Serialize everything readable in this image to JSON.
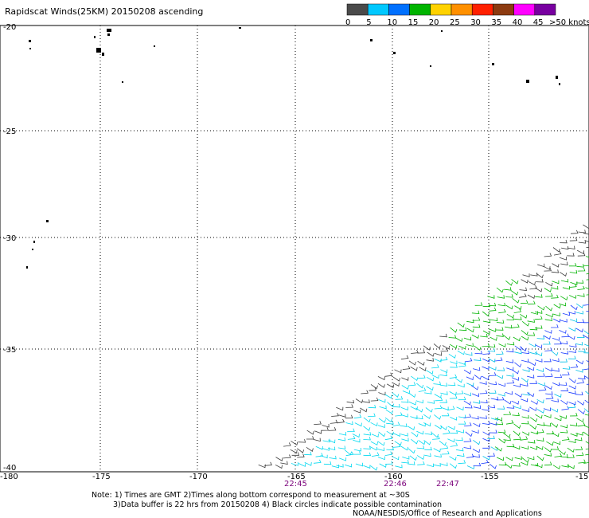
{
  "title": "Rapidscat Winds(25KM) 20150208 ascending",
  "legend": {
    "colors": [
      "#4a4a4a",
      "#00c8ff",
      "#0070ff",
      "#00b400",
      "#ffd200",
      "#ff9000",
      "#ff2000",
      "#8c3a10",
      "#ff00ff",
      "#7800a0"
    ],
    "labels": [
      "0",
      "5",
      "10",
      "15",
      "20",
      "25",
      "30",
      "35",
      "40",
      "45",
      ">50 knots"
    ]
  },
  "lat_labels": [
    "-20",
    "-25",
    "-30",
    "-35",
    "-40"
  ],
  "lon_labels": [
    "-180",
    "-175",
    "-170",
    "-165",
    "-160",
    "-155",
    "-15"
  ],
  "times": [
    "22:45",
    "22:46",
    "22:47"
  ],
  "notes": [
    "Note: 1) Times are GMT 2)Times along bottom correspond to measurement at ~30S",
    "3)Data buffer is 22 hrs from 20150208 4) Black circles indicate possible contamination",
    "NOAA/NESDIS/Office of Research and Applications"
  ]
}
